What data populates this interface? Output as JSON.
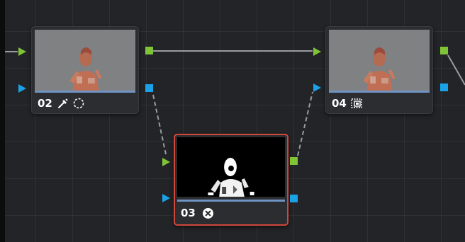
{
  "node_graph": {
    "nodes": [
      {
        "id": "n02",
        "label": "02",
        "tools": [
          "qualifier-picker-icon",
          "window-circle-icon"
        ],
        "thumbnail": "color-image",
        "selected": false
      },
      {
        "id": "n03",
        "label": "03",
        "tools": [
          "fx-icon"
        ],
        "thumbnail": "key-matte",
        "selected": true
      },
      {
        "id": "n04",
        "label": "04",
        "tools": [
          "layer-mixer-icon"
        ],
        "thumbnail": "color-image",
        "selected": false
      }
    ]
  },
  "colors": {
    "background": "#232427",
    "rgb_port": "#7fc337",
    "key_port": "#1ba1e6",
    "selection_border": "#d0473c",
    "node_bar": "#6e93c4"
  }
}
